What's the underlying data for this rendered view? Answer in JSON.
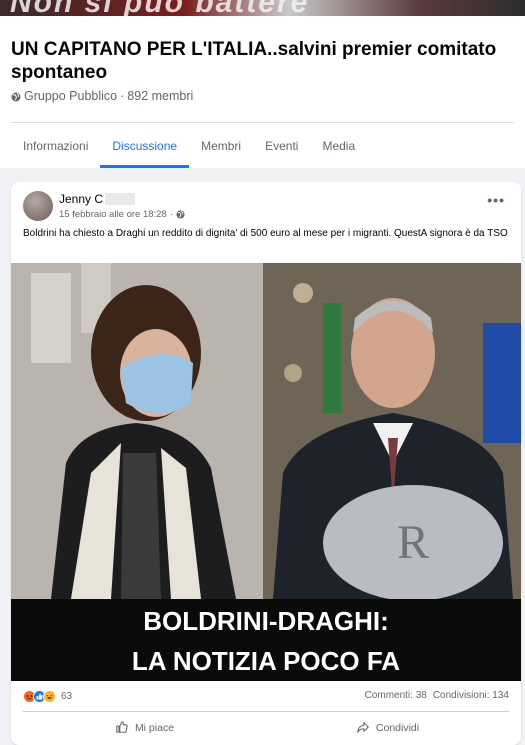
{
  "cover": {
    "text": "Non si può battere"
  },
  "group": {
    "title": "UN CAPITANO PER L'ITALIA..salvini premier comitato spontaneo",
    "privacy": "Gruppo Pubblico",
    "separator": "·",
    "members": "892 membri"
  },
  "tabs": [
    {
      "label": "Informazioni"
    },
    {
      "label": "Discussione"
    },
    {
      "label": "Membri"
    },
    {
      "label": "Eventi"
    },
    {
      "label": "Media"
    }
  ],
  "active_tab": "Discussione",
  "post": {
    "author": "Jenny C",
    "time": "15 febbraio alle ore 18:28",
    "time_separator": "·",
    "more": "•••",
    "text": "Boldrini ha chiesto a Draghi un reddito di dignita' di 500 euro al mese per i migranti. QuestA signora è da TSO",
    "image_caption": {
      "line1": "BOLDRINI-DRAGHI:",
      "line2": "LA NOTIZIA POCO FA"
    },
    "reactions": {
      "icons": [
        "angry-reaction-icon",
        "like-reaction-icon",
        "haha-reaction-icon"
      ],
      "count": "63"
    },
    "comments": "Commenti: 38",
    "shares": "Condivisioni: 134",
    "actions": {
      "like": "Mi piace",
      "share": "Condividi"
    }
  },
  "colors": {
    "accent": "#1877f2",
    "secondary_text": "#65676b",
    "background": "#f0f2f5"
  }
}
